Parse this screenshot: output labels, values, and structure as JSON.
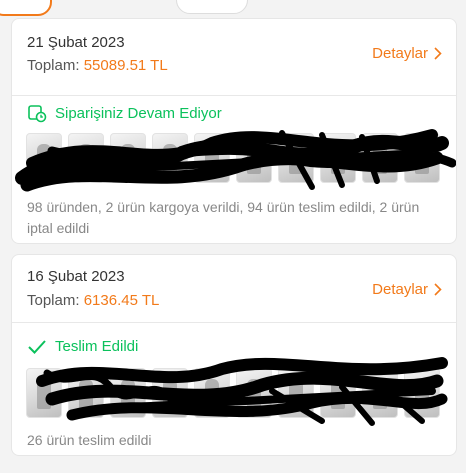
{
  "orders": [
    {
      "date": "21 Şubat 2023",
      "total_label": "Toplam:",
      "total_amount": "55089.51 TL",
      "detail_label": "Detaylar",
      "status": "Siparişiniz Devam Ediyor",
      "status_icon": "clock-box-icon",
      "summary": "98 üründen, 2 ürün kargoya verildi, 94 ürün teslim edildi, 2 ürün iptal edildi"
    },
    {
      "date": "16 Şubat 2023",
      "total_label": "Toplam:",
      "total_amount": "6136.45 TL",
      "detail_label": "Detaylar",
      "status": "Teslim Edildi",
      "status_icon": "check-icon",
      "summary": "26 ürün teslim edildi"
    }
  ],
  "colors": {
    "accent": "#f27a1a",
    "success": "#0bc15c",
    "text": "#333333",
    "muted": "#888888"
  }
}
